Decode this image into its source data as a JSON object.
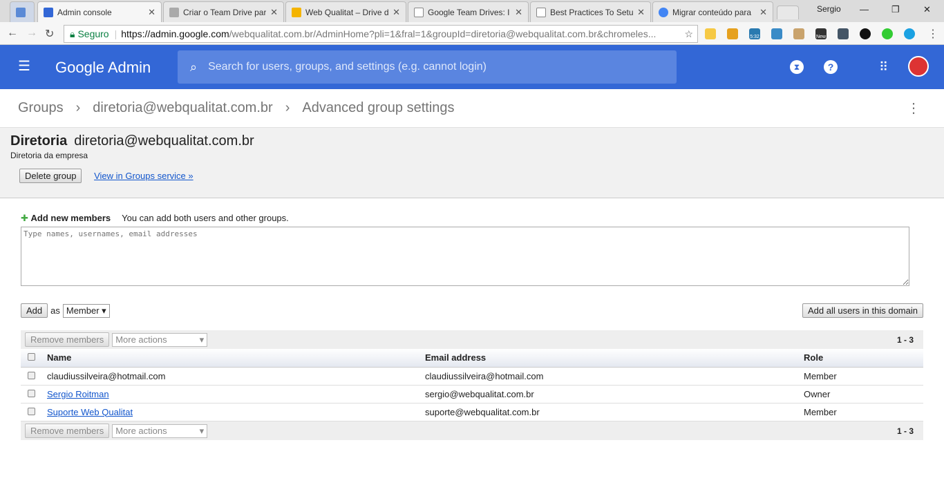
{
  "browser": {
    "tabs": [
      {
        "title": "Admin console",
        "active": true
      },
      {
        "title": "Criar o Team Drive par"
      },
      {
        "title": "Web Qualitat – Drive d"
      },
      {
        "title": "Google Team Drives: I"
      },
      {
        "title": "Best Practices To Setu"
      },
      {
        "title": "Migrar conteúdo para"
      }
    ],
    "user": "Sergio",
    "secure_label": "Seguro",
    "url_host": "https://admin.google.com",
    "url_path": "/webqualitat.com.br/AdminHome?pli=1&fral=1&groupId=diretoria@webqualitat.com.br&chromeles...",
    "ext_badges": [
      "5:32",
      "New"
    ]
  },
  "header": {
    "logo": "Google Admin",
    "search_placeholder": "Search for users, groups, and settings (e.g. cannot login)"
  },
  "breadcrumb": [
    "Groups",
    "diretoria@webqualitat.com.br",
    "Advanced group settings"
  ],
  "group": {
    "name": "Diretoria",
    "email": "diretoria@webqualitat.com.br",
    "description": "Diretoria da empresa",
    "delete_label": "Delete group",
    "view_link": "View in Groups service »"
  },
  "add": {
    "title": "Add new members",
    "hint": "You can add both users and other groups.",
    "placeholder": "Type names, usernames, email addresses",
    "add_label": "Add",
    "as_label": "as",
    "role": "Member",
    "add_all_label": "Add all users in this domain"
  },
  "members": {
    "remove_label": "Remove members",
    "more_actions": "More actions",
    "count": "1 - 3",
    "columns": [
      "Name",
      "Email address",
      "Role"
    ],
    "rows": [
      {
        "name": "claudiussilveira@hotmail.com",
        "email": "claudiussilveira@hotmail.com",
        "role": "Member",
        "link": false
      },
      {
        "name": "Sergio Roitman",
        "email": "sergio@webqualitat.com.br",
        "role": "Owner",
        "link": true
      },
      {
        "name": "Suporte Web Qualitat",
        "email": "suporte@webqualitat.com.br",
        "role": "Member",
        "link": true
      }
    ]
  }
}
